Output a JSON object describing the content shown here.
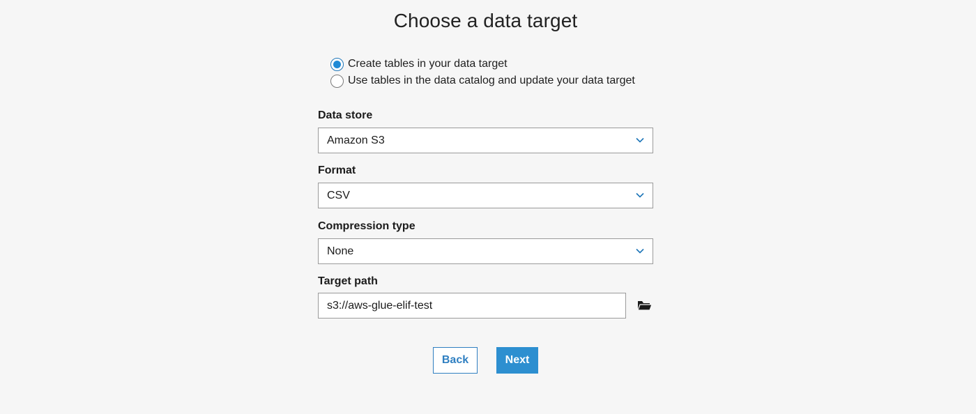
{
  "title": "Choose a data target",
  "target_options": [
    {
      "label": "Create tables in your data target",
      "selected": true
    },
    {
      "label": "Use tables in the data catalog and update your data target",
      "selected": false
    }
  ],
  "data_store": {
    "label": "Data store",
    "value": "Amazon S3"
  },
  "format": {
    "label": "Format",
    "value": "CSV"
  },
  "compression": {
    "label": "Compression type",
    "value": "None"
  },
  "target_path": {
    "label": "Target path",
    "value": "s3://aws-glue-elif-test"
  },
  "buttons": {
    "back": "Back",
    "next": "Next"
  },
  "colors": {
    "accent": "#1f8ad6",
    "primary_button": "#2d8fd0",
    "background": "#f6f6f6"
  },
  "icons": {
    "dropdown": "chevron-down-icon",
    "browse": "folder-open-icon"
  }
}
